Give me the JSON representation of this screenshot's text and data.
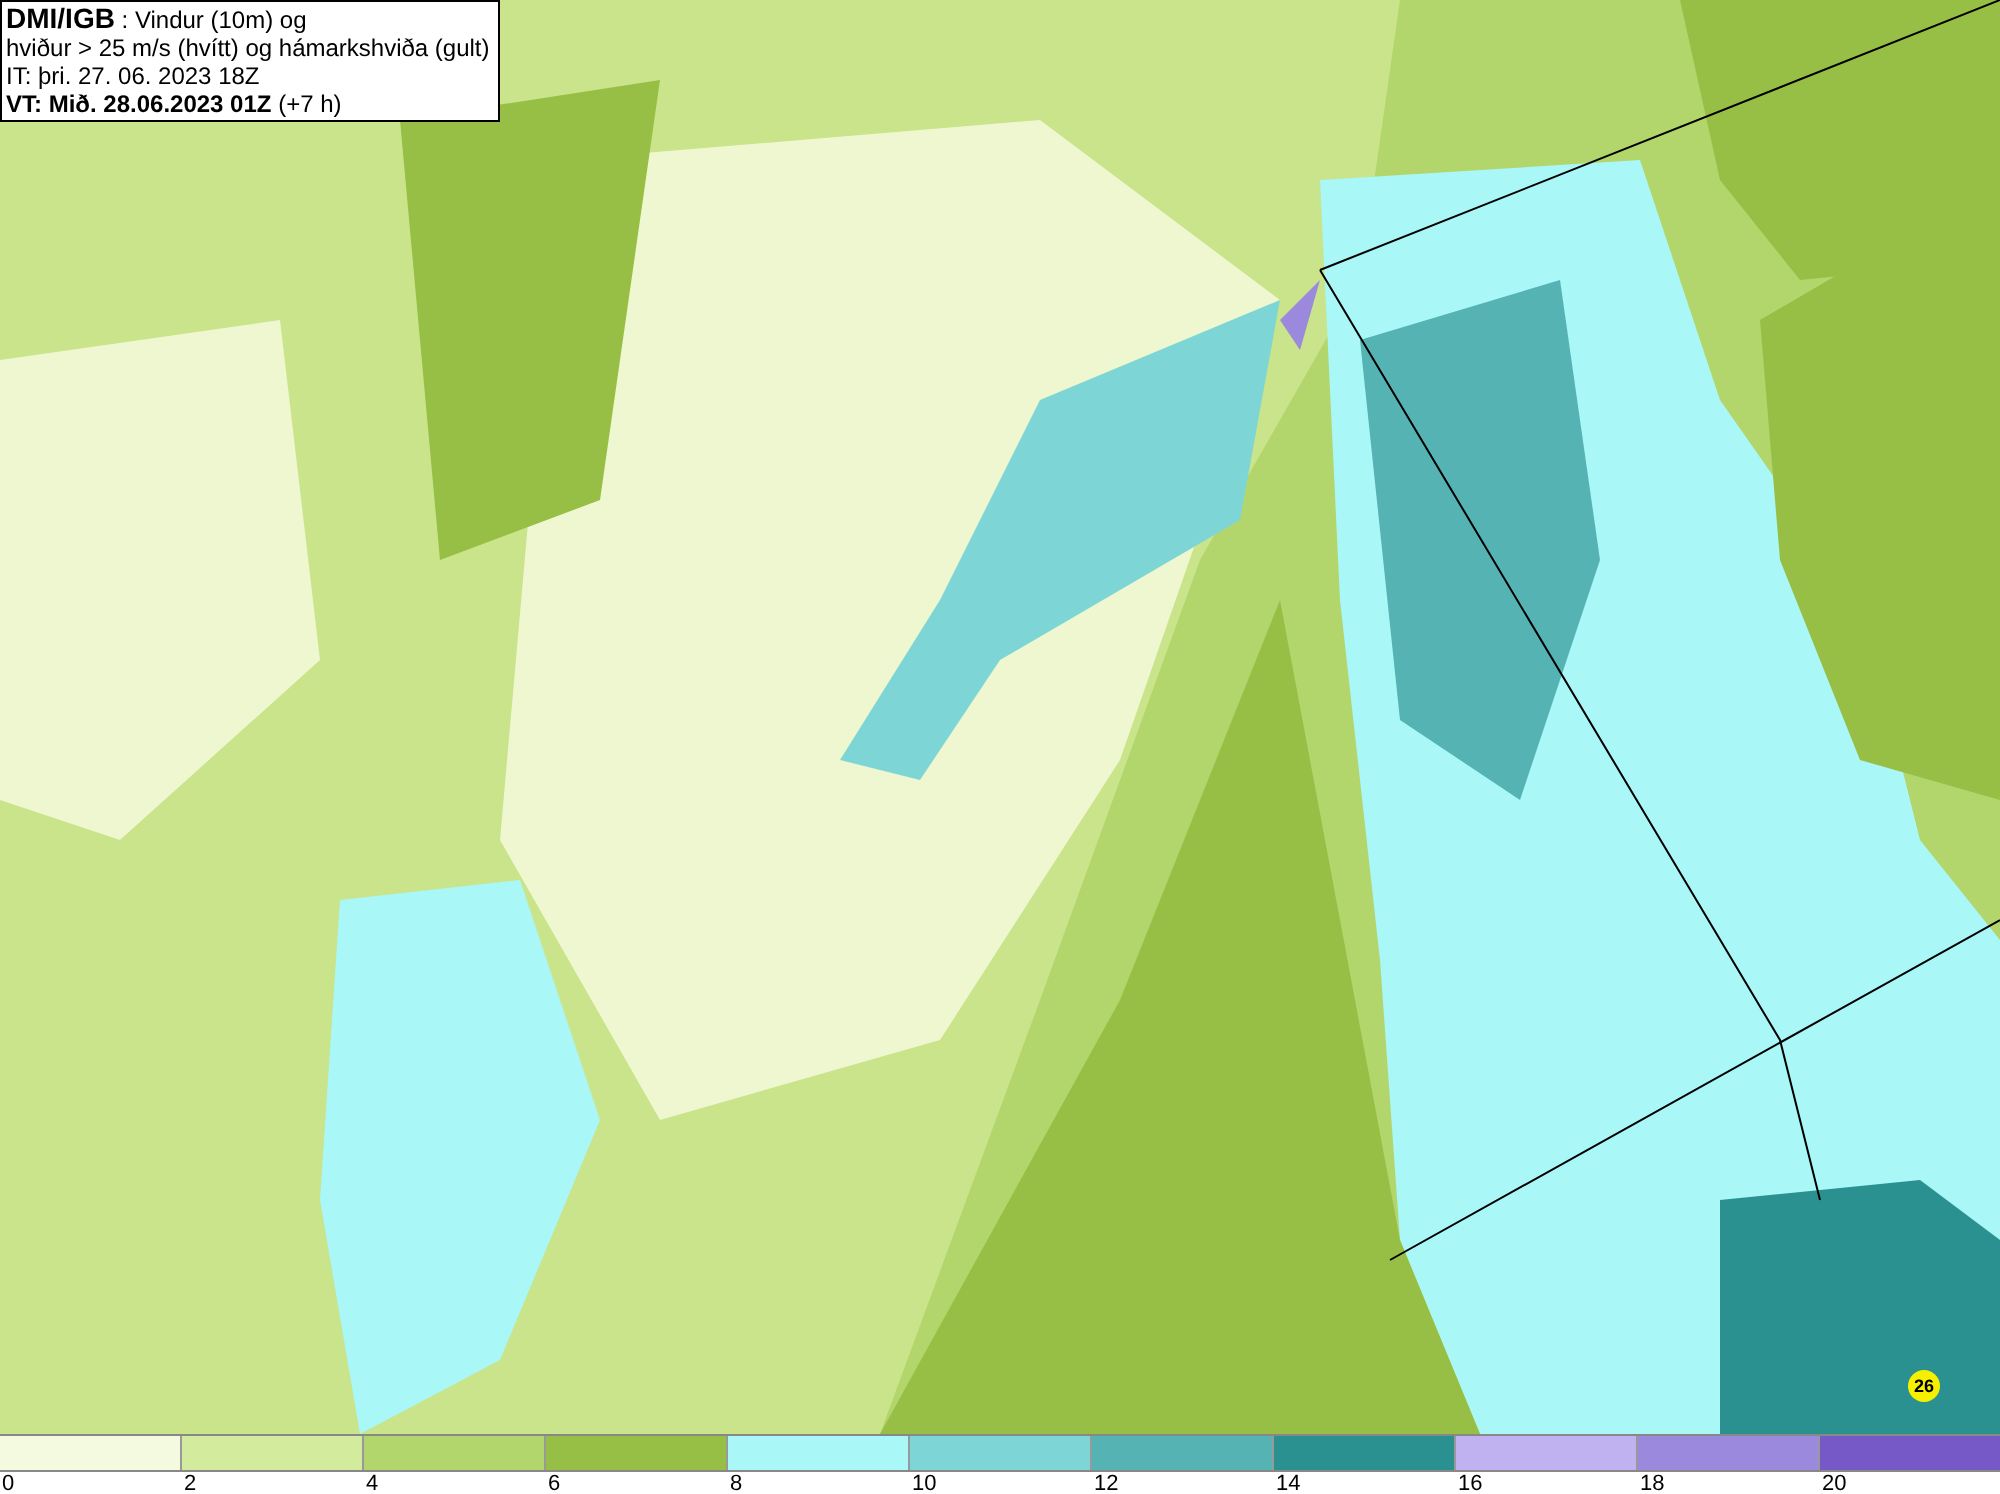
{
  "map": {
    "title_lines": [
      "**DMI/IGB** : Vindur (10m) og",
      "hviður > 25 m/s (hvítt) og hámarkshviða (gult)",
      "IT: þri. 27. 06. 2023 18Z",
      "**VT: Mið. 28.06.2023 01Z** (+7 h)"
    ],
    "gust_marker": {
      "text": "26"
    }
  },
  "legend": {
    "items": [
      {
        "label": "0",
        "color": "#f4fadf"
      },
      {
        "label": "2",
        "color": "#d3eb9c"
      },
      {
        "label": "4",
        "color": "#b3d66c"
      },
      {
        "label": "6",
        "color": "#98bf45"
      },
      {
        "label": "8",
        "color": "#a9f7f7"
      },
      {
        "label": "10",
        "color": "#7ed5d6"
      },
      {
        "label": "12",
        "color": "#56b3b3"
      },
      {
        "label": "14",
        "color": "#2b9090"
      },
      {
        "label": "16",
        "color": "#c0b1f1"
      },
      {
        "label": "18",
        "color": "#9b89de"
      },
      {
        "label": "20",
        "color": "#7659c7"
      }
    ]
  }
}
